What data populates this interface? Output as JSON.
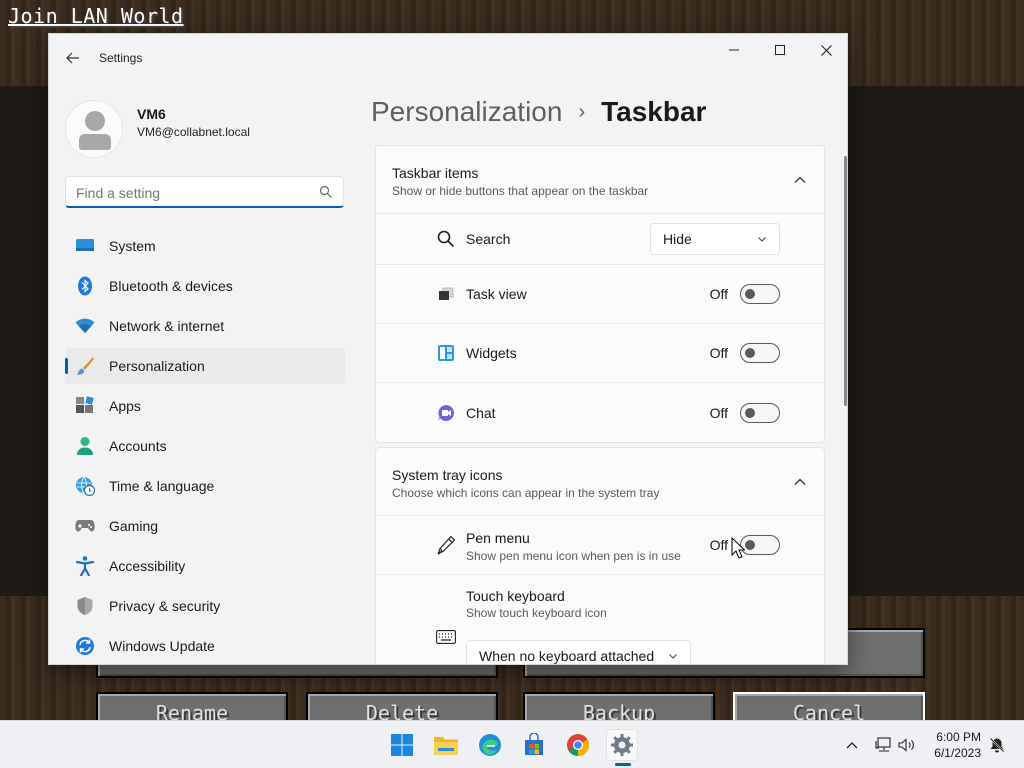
{
  "game": {
    "title": "Join LAN World",
    "buttons": {
      "rename": "Rename",
      "delete": "Delete",
      "backup": "Backup",
      "cancel": "Cancel"
    }
  },
  "window": {
    "app_title": "Settings",
    "controls": {
      "minimize": "—",
      "maximize": "☐",
      "close": "✕"
    }
  },
  "profile": {
    "name": "VM6",
    "email": "VM6@collabnet.local"
  },
  "search": {
    "placeholder": "Find a setting"
  },
  "sidebar": {
    "items": [
      {
        "label": "System",
        "icon": "monitor-icon"
      },
      {
        "label": "Bluetooth & devices",
        "icon": "bluetooth-icon"
      },
      {
        "label": "Network & internet",
        "icon": "wifi-icon"
      },
      {
        "label": "Personalization",
        "icon": "brush-icon",
        "active": true
      },
      {
        "label": "Apps",
        "icon": "apps-icon"
      },
      {
        "label": "Accounts",
        "icon": "person-icon"
      },
      {
        "label": "Time & language",
        "icon": "globe-clock-icon"
      },
      {
        "label": "Gaming",
        "icon": "gamepad-icon"
      },
      {
        "label": "Accessibility",
        "icon": "accessibility-icon"
      },
      {
        "label": "Privacy & security",
        "icon": "shield-icon"
      },
      {
        "label": "Windows Update",
        "icon": "update-icon"
      }
    ]
  },
  "breadcrumb": {
    "parent": "Personalization",
    "separator": "›",
    "current": "Taskbar"
  },
  "taskbar_items": {
    "title": "Taskbar items",
    "description": "Show or hide buttons that appear on the taskbar",
    "search": {
      "label": "Search",
      "value": "Hide"
    },
    "task_view": {
      "label": "Task view",
      "state": "Off"
    },
    "widgets": {
      "label": "Widgets",
      "state": "Off"
    },
    "chat": {
      "label": "Chat",
      "state": "Off"
    }
  },
  "system_tray": {
    "title": "System tray icons",
    "description": "Choose which icons can appear in the system tray",
    "pen_menu": {
      "label": "Pen menu",
      "description": "Show pen menu icon when pen is in use",
      "state": "Off"
    },
    "touch_keyboard": {
      "label": "Touch keyboard",
      "description": "Show touch keyboard icon",
      "value": "When no keyboard attached"
    }
  },
  "taskbar": {
    "time": "6:00 PM",
    "date": "6/1/2023"
  },
  "colors": {
    "accent": "#005fb8",
    "window_bg": "#f3f3f3",
    "card_bg": "#fbfbfb"
  }
}
